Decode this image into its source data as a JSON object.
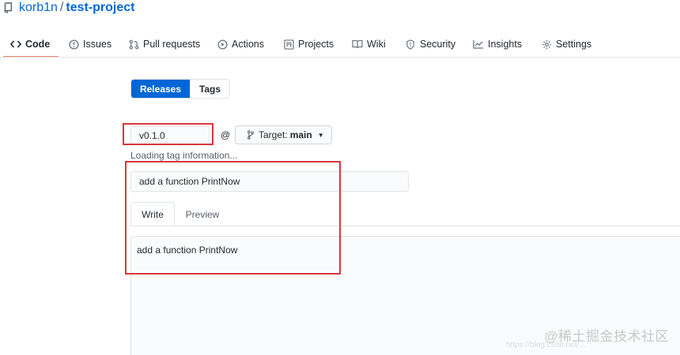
{
  "repo": {
    "owner": "korb1n",
    "separator": "/",
    "name": "test-project",
    "icon": "repo-icon"
  },
  "nav": {
    "tabs": [
      {
        "label": "Code",
        "icon": "code-icon",
        "selected": true
      },
      {
        "label": "Issues",
        "icon": "issue-opened-icon"
      },
      {
        "label": "Pull requests",
        "icon": "git-pull-request-icon"
      },
      {
        "label": "Actions",
        "icon": "play-icon"
      },
      {
        "label": "Projects",
        "icon": "project-icon"
      },
      {
        "label": "Wiki",
        "icon": "book-icon"
      },
      {
        "label": "Security",
        "icon": "shield-icon"
      },
      {
        "label": "Insights",
        "icon": "graph-icon"
      },
      {
        "label": "Settings",
        "icon": "gear-icon"
      }
    ]
  },
  "subnav": {
    "releases": "Releases",
    "tags": "Tags"
  },
  "release_form": {
    "tag_value": "v0.1.0",
    "at": "@",
    "target_label": "Target:",
    "target_branch": "main",
    "loading": "Loading tag information...",
    "title_value": "add a function PrintNow",
    "write_tab": "Write",
    "preview_tab": "Preview",
    "body_value": "add a function PrintNow"
  },
  "watermark": {
    "text": "@稀土掘金技术社区",
    "faint_url": "https://blog.csdn.net/..."
  },
  "colors": {
    "accent": "#0366d6",
    "tab_underline": "#f9826c",
    "annotation": "#d9363e"
  }
}
